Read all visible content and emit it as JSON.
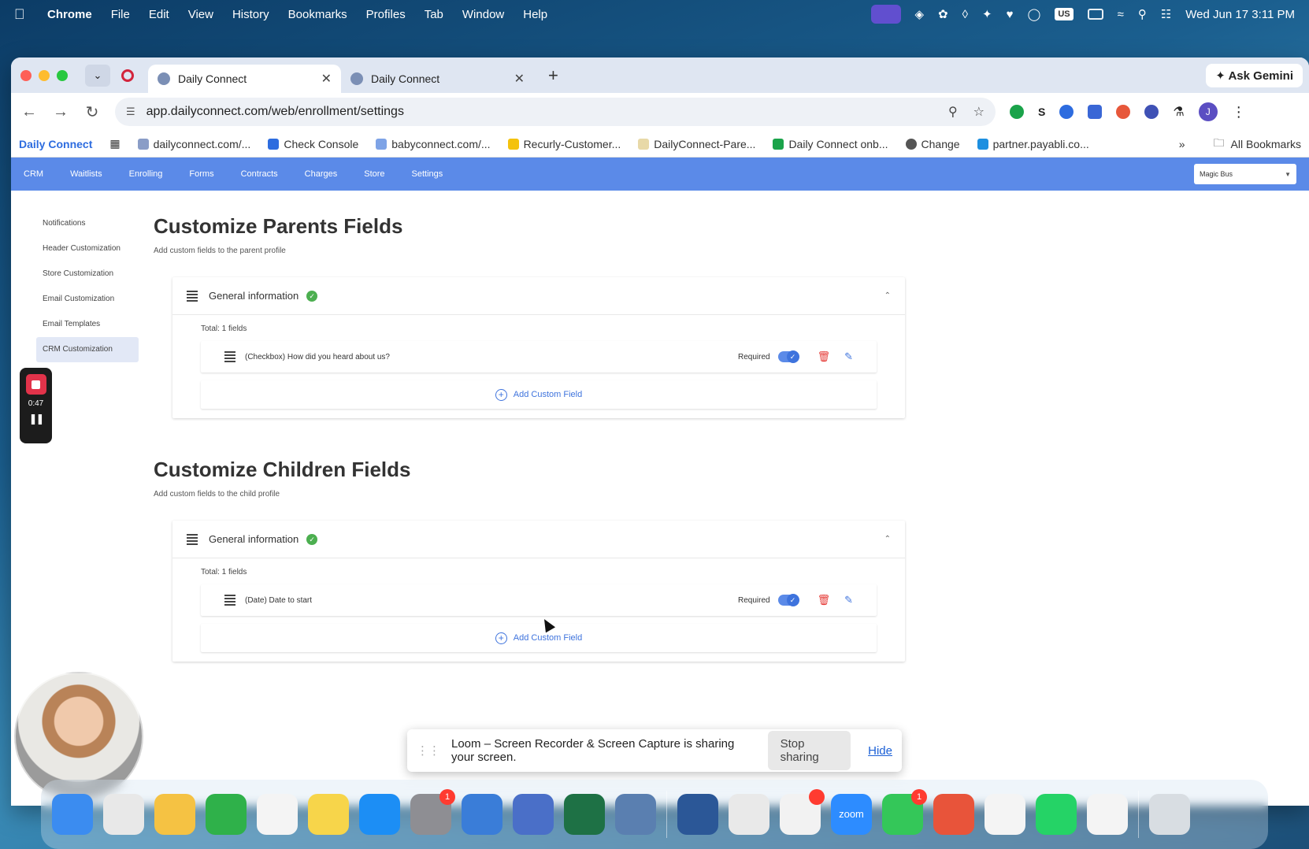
{
  "menubar": {
    "app": "Chrome",
    "items": [
      "File",
      "Edit",
      "View",
      "History",
      "Bookmarks",
      "Profiles",
      "Tab",
      "Window",
      "Help"
    ],
    "keyboard": "US",
    "datetime": "Wed Jun 17  3:11 PM"
  },
  "browser": {
    "tabs": [
      {
        "title": "Daily Connect",
        "active": true
      },
      {
        "title": "Daily Connect",
        "active": false
      }
    ],
    "ask_gemini": "Ask Gemini",
    "url": "app.dailyconnect.com/web/enrollment/settings",
    "profile_initial": "J",
    "bookmarks": [
      "Daily Connect",
      "dailyconnect.com/...",
      "Check Console",
      "babyconnect.com/...",
      "Recurly-Customer...",
      "DailyConnect-Pare...",
      "Daily Connect onb...",
      "Change",
      "partner.payabli.co..."
    ],
    "bookmarks_overflow": "»",
    "all_bookmarks": "All Bookmarks"
  },
  "app": {
    "nav": [
      "CRM",
      "Waitlists",
      "Enrolling",
      "Forms",
      "Contracts",
      "Charges",
      "Store",
      "Settings"
    ],
    "center": "Magic Bus",
    "sidebar": [
      {
        "label": "Notifications",
        "active": false
      },
      {
        "label": "Header Customization",
        "active": false
      },
      {
        "label": "Store Customization",
        "active": false
      },
      {
        "label": "Email Customization",
        "active": false
      },
      {
        "label": "Email Templates",
        "active": false
      },
      {
        "label": "CRM Customization",
        "active": true
      }
    ],
    "parents": {
      "title": "Customize Parents Fields",
      "subtitle": "Add custom fields to the parent profile",
      "group_title": "General information",
      "total": "Total: 1 fields",
      "field": "(Checkbox) How did you heard about us?",
      "required": "Required",
      "add": "Add Custom Field"
    },
    "children": {
      "title": "Customize Children Fields",
      "subtitle": "Add custom fields to the child profile",
      "group_title": "General information",
      "total": "Total: 1 fields",
      "field": "(Date) Date to start",
      "required": "Required",
      "add": "Add Custom Field"
    }
  },
  "loom": {
    "timer": "0:47",
    "message": "Loom – Screen Recorder & Screen Capture is sharing your screen.",
    "stop": "Stop sharing",
    "hide": "Hide"
  },
  "dock": {
    "apps": [
      {
        "name": "finder",
        "color": "#3b8cf0"
      },
      {
        "name": "launchpad",
        "color": "#e8e8e8"
      },
      {
        "name": "photos",
        "color": "#f5c243"
      },
      {
        "name": "numbers",
        "color": "#2fb14a"
      },
      {
        "name": "reminders",
        "color": "#f4f4f4"
      },
      {
        "name": "notes",
        "color": "#f7d54a"
      },
      {
        "name": "app-store",
        "color": "#1c8ef5"
      },
      {
        "name": "system-settings",
        "color": "#8e8e93",
        "badge": "1"
      },
      {
        "name": "migration",
        "color": "#3a7dd8"
      },
      {
        "name": "simulator",
        "color": "#4a6fc8"
      },
      {
        "name": "excel",
        "color": "#1e7145"
      },
      {
        "name": "viewer",
        "color": "#5a7fb0"
      },
      {
        "name": "word",
        "color": "#2b5797"
      },
      {
        "name": "chrome",
        "color": "#e9e9e9"
      },
      {
        "name": "slack",
        "color": "#f2f2f2",
        "badge": ""
      },
      {
        "name": "zoom",
        "color": "#2d8cff",
        "label": "zoom"
      },
      {
        "name": "messages",
        "color": "#34c759",
        "badge": "1"
      },
      {
        "name": "claude",
        "color": "#e8543a"
      },
      {
        "name": "asana",
        "color": "#f4f4f4"
      },
      {
        "name": "whatsapp",
        "color": "#25d366"
      },
      {
        "name": "chatgpt",
        "color": "#f4f4f4"
      },
      {
        "name": "trash",
        "color": "#d8dde2"
      }
    ]
  }
}
